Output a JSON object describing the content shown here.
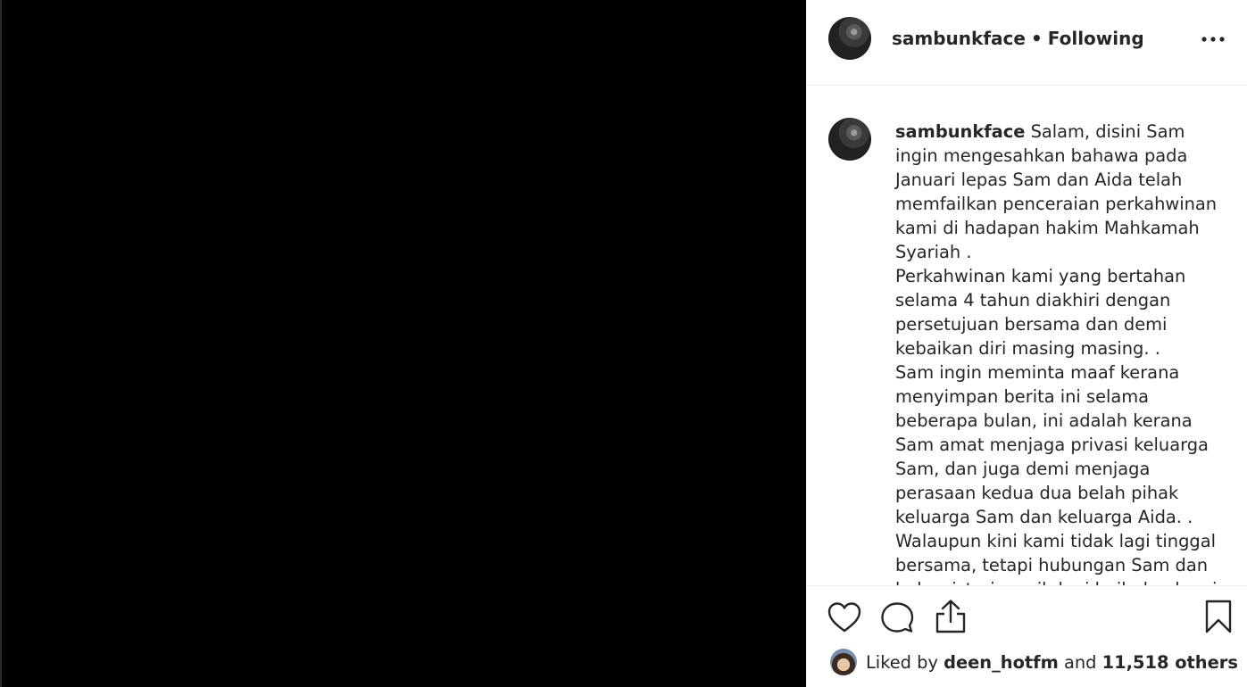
{
  "post": {
    "username": "sambunkface",
    "separator": "•",
    "follow_status": "Following",
    "caption_username": "sambunkface",
    "caption_text": "Salam, disini Sam ingin mengesahkan bahawa pada Januari lepas Sam dan Aida telah memfailkan penceraian perkahwinan kami di hadapan hakim Mahkamah Syariah .\nPerkahwinan kami yang bertahan selama 4 tahun diakhiri dengan persetujuan bersama dan demi kebaikan diri masing masing. .\nSam ingin meminta maaf kerana menyimpan berita ini selama beberapa bulan, ini adalah kerana Sam amat menjaga privasi keluarga Sam, dan juga demi menjaga perasaan kedua dua belah pihak keluarga Sam dan keluarga Aida. .\nWalaupun kini kami tidak lagi tinggal bersama, tetapi hubungan Sam dan bekas isteri masih lagi baik dan kami"
  },
  "likes": {
    "prefix": "Liked by",
    "liker": "deen_hotfm",
    "conjunction": "and",
    "others": "11,518 others"
  },
  "icons": {
    "more": "more-horizontal-icon",
    "like": "heart-icon",
    "comment": "comment-icon",
    "share": "share-icon",
    "save": "bookmark-icon"
  }
}
